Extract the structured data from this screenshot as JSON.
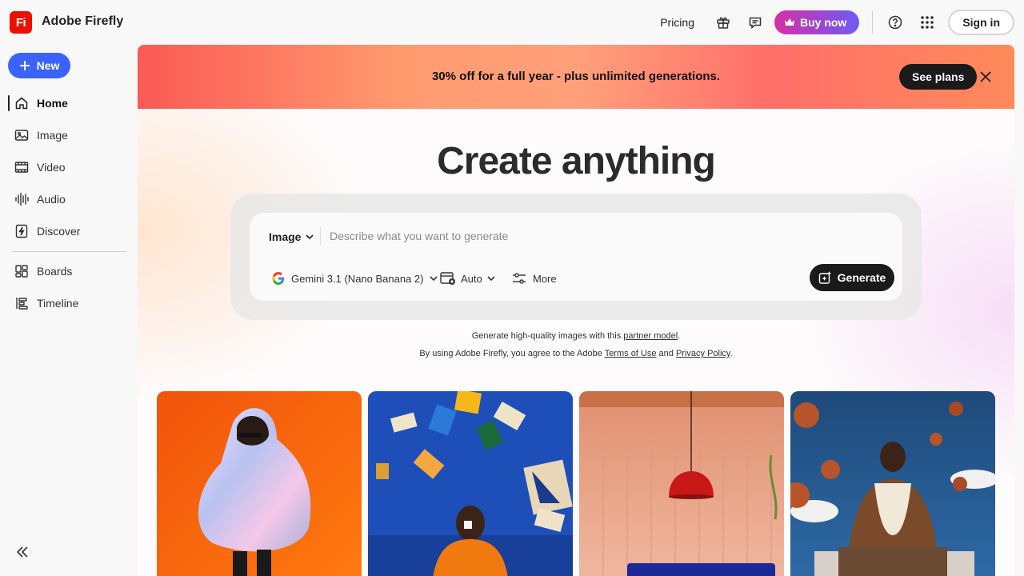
{
  "app": {
    "logo_text": "Fi",
    "title": "Adobe Firefly"
  },
  "topbar": {
    "pricing_label": "Pricing",
    "buy_label": "Buy now",
    "signin_label": "Sign in"
  },
  "sidebar": {
    "new_label": "New",
    "items": [
      {
        "label": "Home",
        "icon": "home-icon",
        "active": true
      },
      {
        "label": "Image",
        "icon": "image-icon"
      },
      {
        "label": "Video",
        "icon": "video-icon"
      },
      {
        "label": "Audio",
        "icon": "audio-icon"
      },
      {
        "label": "Discover",
        "icon": "discover-icon"
      },
      {
        "label": "Boards",
        "icon": "boards-icon"
      },
      {
        "label": "Timeline",
        "icon": "timeline-icon"
      }
    ]
  },
  "promo": {
    "text": "30% off for a full year - plus unlimited generations.",
    "cta_label": "See plans"
  },
  "hero": {
    "title": "Create anything"
  },
  "prompt": {
    "type_label": "Image",
    "placeholder": "Describe what you want to generate",
    "model_label": "Gemini 3.1 (Nano Banana 2)",
    "aspect_label": "Auto",
    "more_label": "More",
    "generate_label": "Generate"
  },
  "legal": {
    "line1_prefix": "Generate high-quality images with this ",
    "line1_link": "partner model",
    "line1_suffix": ".",
    "line2_prefix": "By using Adobe Firefly, you agree to the Adobe ",
    "terms_link": "Terms of Use",
    "and": " and ",
    "privacy_link": "Privacy Policy",
    "line2_suffix": "."
  },
  "colors": {
    "brand_red": "#eb1000",
    "new_button": "#3b63fb",
    "buy_gradient_start": "#d62fa5",
    "buy_gradient_end": "#6d5cf5"
  }
}
